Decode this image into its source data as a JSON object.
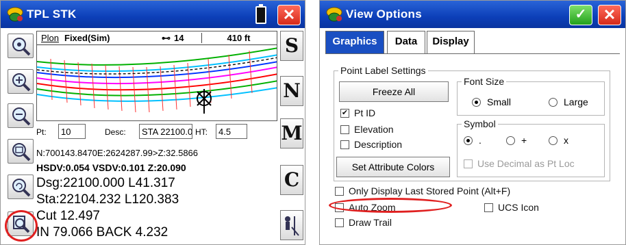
{
  "left": {
    "title": "TPL STK",
    "toolbar": [
      "zoom-extents-icon",
      "zoom-in-icon",
      "zoom-out-icon",
      "zoom-window-icon",
      "zoom-previous-icon",
      "auto-zoom-icon"
    ],
    "side_buttons": [
      "S",
      "N",
      "M",
      "C"
    ],
    "map": {
      "tab": "Plon",
      "status": "Fixed(Sim)",
      "satellites": "14",
      "scale": "410 ft"
    },
    "fields": {
      "pt_label": "Pt:",
      "pt_value": "10",
      "desc_label": "Desc:",
      "desc_value": "STA 22100.0",
      "ht_label": "HT:",
      "ht_value": "4.5"
    },
    "info": {
      "coords": "N:700143.8470E:2624287.99>Z:32.5866",
      "precision": "HSDV:0.054 VSDV:0.101 Z:20.090",
      "dsg": "Dsg:22100.000 L41.317",
      "sta": "Sta:22104.232 L120.383",
      "cut": "Cut 12.497",
      "in_back": "IN 79.066 BACK 4.232"
    }
  },
  "right": {
    "title": "View Options",
    "tabs": [
      "Graphics",
      "Data",
      "Display"
    ],
    "point_label_group": "Point Label Settings",
    "freeze_all": "Freeze All",
    "pt_id": "Pt ID",
    "elevation": "Elevation",
    "description": "Description",
    "set_attr_colors": "Set Attribute Colors",
    "font_size_group": "Font Size",
    "font_small": "Small",
    "font_large": "Large",
    "symbol_group": "Symbol",
    "symbol_dot": ".",
    "symbol_plus": "+",
    "symbol_x": "x",
    "use_decimal": "Use Decimal as Pt Loc",
    "only_last": "Only Display Last Stored Point (Alt+F)",
    "auto_zoom": "Auto Zoom",
    "ucs_icon": "UCS Icon",
    "draw_trail": "Draw Trail"
  },
  "colors": {
    "titlebar": "#0c3fb8",
    "highlight": "#e02020",
    "tab_active": "#1a4fc2"
  }
}
